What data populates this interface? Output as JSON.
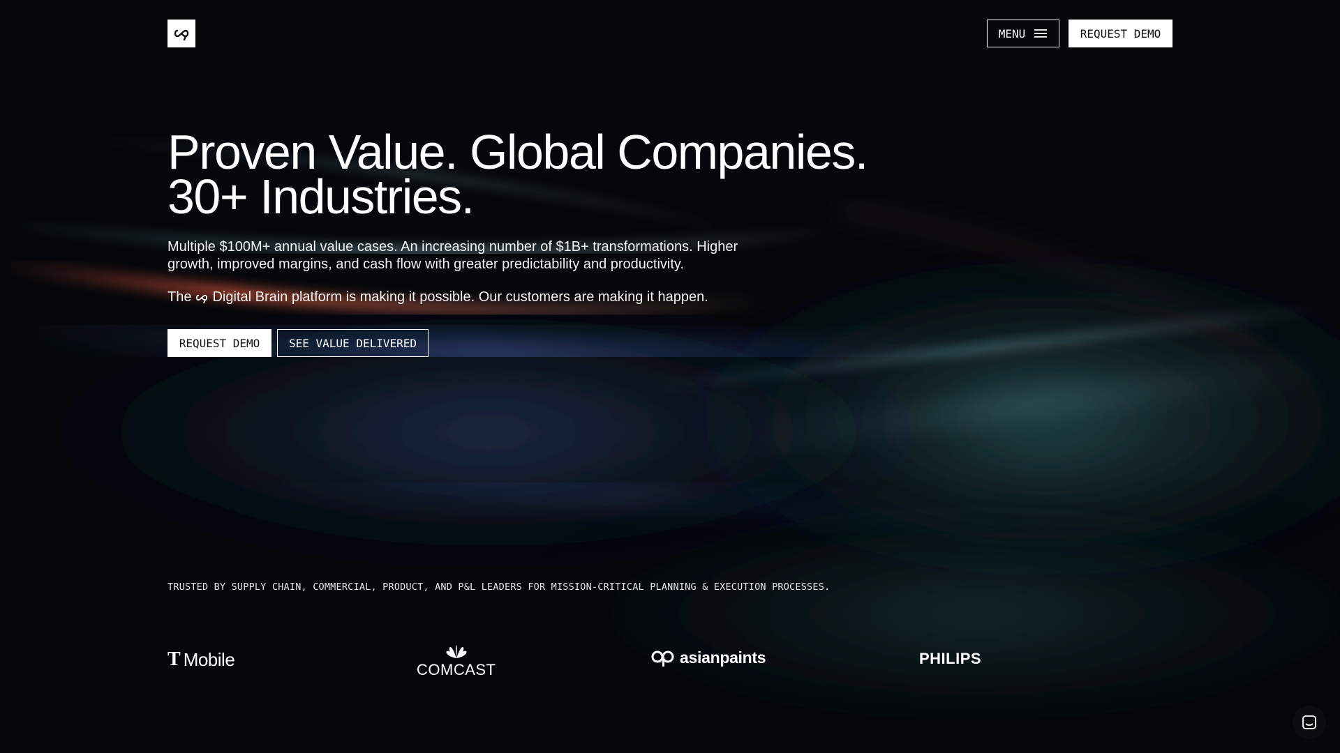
{
  "header": {
    "logo_icon": "brand-infinity-icon",
    "menu_label": "MENU",
    "menu_icon": "hamburger-icon",
    "request_demo_label": "REQUEST DEMO"
  },
  "hero": {
    "title_line1": "Proven Value. Global Companies.",
    "title_line2": "30+ Industries.",
    "subtitle": "Multiple $100M+ annual value cases. An increasing number of $1B+ transformations. Higher growth, improved margins, and cash flow with greater predictability and productivity.",
    "platform_prefix": "The",
    "platform_suffix": "Digital Brain platform is making it possible. Our customers are making it happen.",
    "cta_primary": "REQUEST DEMO",
    "cta_secondary": "SEE VALUE DELIVERED"
  },
  "trusted": {
    "text": "TRUSTED BY SUPPLY CHAIN, COMMERCIAL, PRODUCT, AND P&L LEADERS FOR MISSION-CRITICAL PLANNING & EXECUTION PROCESSES.",
    "logos": [
      {
        "mark": "T",
        "name": "Mobile"
      },
      {
        "name": "COMCAST"
      },
      {
        "name": "asianpaints"
      },
      {
        "name": "PHILIPS"
      }
    ]
  },
  "chat": {
    "icon": "chat-icon"
  },
  "colors": {
    "background": "#05070a",
    "primary_text": "#ffffff",
    "button_fill": "#ffffff",
    "button_text": "#111111"
  }
}
